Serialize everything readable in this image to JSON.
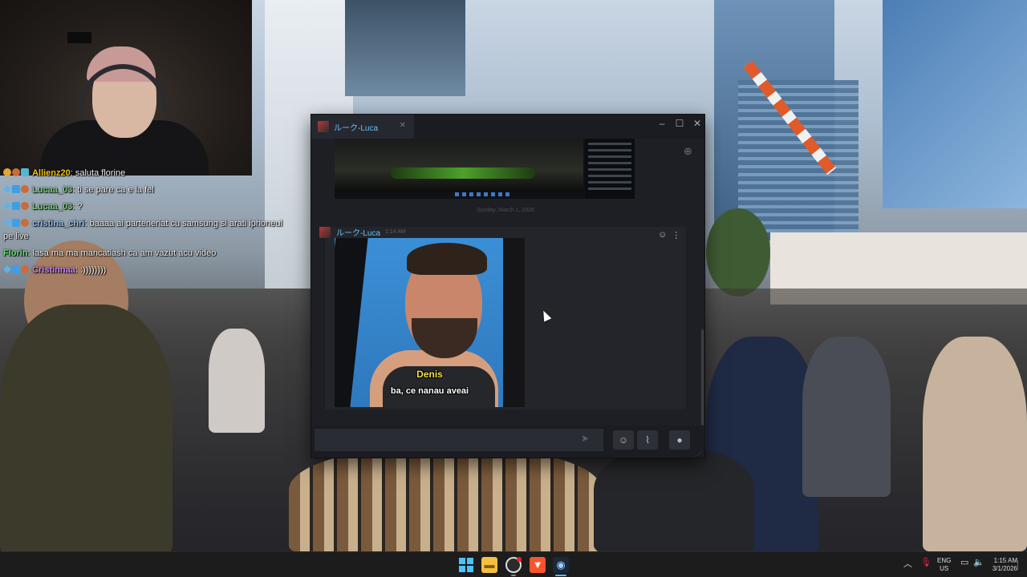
{
  "chat_overlay": {
    "messages": [
      {
        "user": "Allienz20",
        "text": " saluta florine"
      },
      {
        "user": "Lucaa_03",
        "text": " ti se pare ca e la fel"
      },
      {
        "user": "Lucaa_03",
        "text": " ?"
      },
      {
        "user": "cristina_chri",
        "text": " baaaa ai parteneriat cu samsung si arati iphoneul pe live"
      },
      {
        "user": "Florin",
        "text": " lasa ma ma mancatiash ca am vazut acu video"
      },
      {
        "user": "Cristinnaa",
        "text": " :))))))))"
      }
    ]
  },
  "steam_chat": {
    "tab_name": "ルーク-Luca",
    "date_divider": "Sunday, March 1, 2026",
    "message": {
      "author": "ルーク-Luca",
      "time": "1:14 AM",
      "image_caption_name": "Denis",
      "image_caption_line": "ba, ce nanau aveai"
    },
    "input": {
      "value": ""
    }
  },
  "taskbar": {
    "apps": [
      "start-icon",
      "file-explorer-icon",
      "obs-icon",
      "brave-icon",
      "steam-icon"
    ],
    "language": "ENG",
    "region": "US",
    "time": "1:15 AM",
    "date": "3/1/2026"
  },
  "colors": {
    "steam_link_blue": "#66c0f4",
    "steam_window_bg": "#1e1f24",
    "caption_yellow": "#f5e14a",
    "windows_accent": "#4cc2ff"
  }
}
